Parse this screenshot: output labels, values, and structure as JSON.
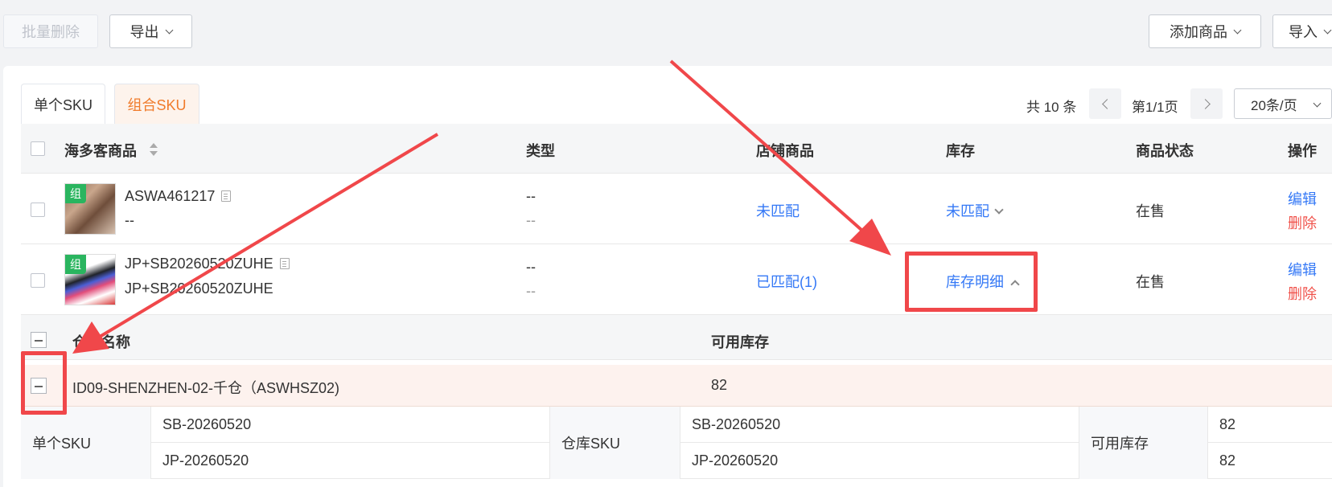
{
  "toolbar": {
    "batch_delete": "批量删除",
    "export": "导出",
    "add_product": "添加商品",
    "import": "导入"
  },
  "tabs": [
    {
      "label": "单个SKU"
    },
    {
      "label": "组合SKU"
    }
  ],
  "pagination": {
    "total": "共 10 条",
    "page": "第1/1页",
    "page_size": "20条/页"
  },
  "table": {
    "headers": {
      "product": "海多客商品",
      "type": "类型",
      "store_product": "店铺商品",
      "stock": "库存",
      "status": "商品状态",
      "actions": "操作"
    },
    "rows": [
      {
        "badge": "组",
        "sku": "ASWA461217",
        "sub": "--",
        "type": "--",
        "type_sub": "--",
        "store": "未匹配",
        "stock": "未匹配",
        "status": "在售",
        "edit": "编辑",
        "delete": "删除"
      },
      {
        "badge": "组",
        "sku": "JP+SB20260520ZUHE",
        "sub": "JP+SB20260520ZUHE",
        "type": "--",
        "type_sub": "--",
        "store": "已匹配(1)",
        "stock": "库存明细",
        "status": "在售",
        "edit": "编辑",
        "delete": "删除"
      }
    ]
  },
  "stock_detail": {
    "headers": {
      "warehouse": "仓库名称",
      "available": "可用库存"
    },
    "warehouse_row": {
      "name": "ID09-SHENZHEN-02-千仓（ASWHSZ02)",
      "available": "82"
    },
    "detail": {
      "single_sku_label": "单个SKU",
      "single_skus": [
        "SB-20260520",
        "JP-20260520"
      ],
      "warehouse_sku_label": "仓库SKU",
      "warehouse_skus": [
        "SB-20260520",
        "JP-20260520"
      ],
      "available_label": "可用库存",
      "available_values": [
        "82",
        "82"
      ]
    }
  },
  "colors": {
    "link": "#3478f6",
    "danger": "#f0524b",
    "combo_tab": "#f07b2b",
    "badge": "#2ab55f",
    "annotation": "#f0474a"
  }
}
